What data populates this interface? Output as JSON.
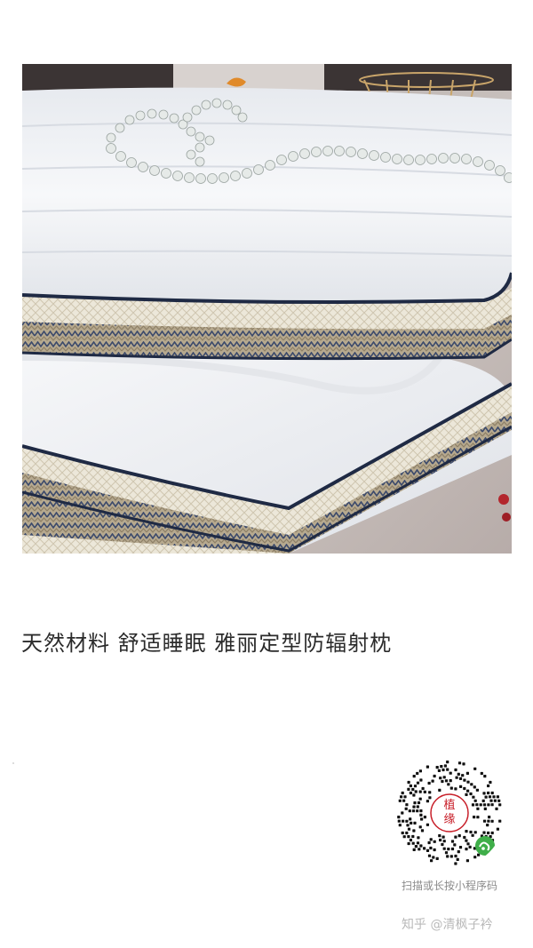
{
  "product": {
    "image_alt": "Two white pillows with navy piping and woven side panels, pearl necklace on top",
    "caption": "天然材料 舒适睡眠 雅丽定型防辐射枕"
  },
  "qr": {
    "center_text": "植缘",
    "hint": "扫描或长按小程序码",
    "badge_icon": "wechat-miniprogram-icon"
  },
  "footer": {
    "watermark": "知乎 @清枫子衿"
  },
  "colors": {
    "pillow_white": "#f4f5f7",
    "piping_navy": "#1f2a44",
    "panel_gold": "#b8a88a",
    "qr_badge_green": "#3fae49",
    "stamp_red": "#c8202a"
  }
}
